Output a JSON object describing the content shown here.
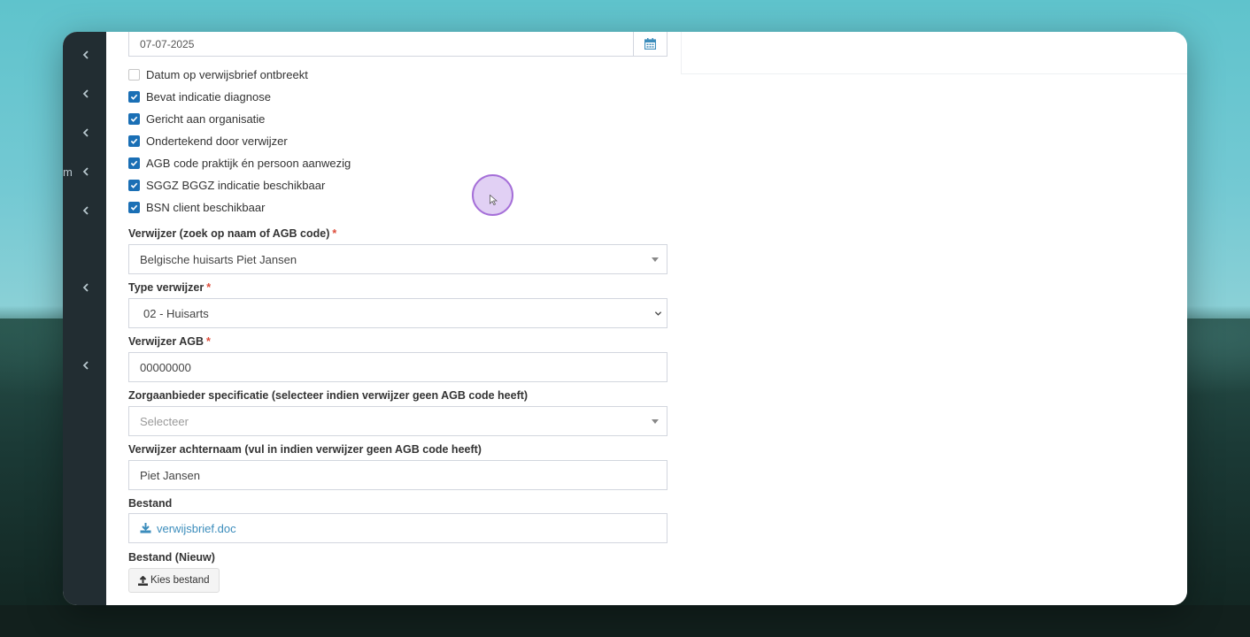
{
  "sidebar": {
    "letter": "m",
    "chevrons": [
      "chevron-left-icon",
      "chevron-left-icon",
      "chevron-left-icon",
      "chevron-left-icon",
      "chevron-left-icon",
      "chevron-left-icon",
      "chevron-left-icon"
    ]
  },
  "date_field": {
    "value": "07-07-2025",
    "icon": "calendar-icon"
  },
  "checkboxes": [
    {
      "label": "Datum op verwijsbrief ontbreekt",
      "checked": false
    },
    {
      "label": "Bevat indicatie diagnose",
      "checked": true
    },
    {
      "label": "Gericht aan organisatie",
      "checked": true
    },
    {
      "label": "Ondertekend door verwijzer",
      "checked": true
    },
    {
      "label": "AGB code praktijk én persoon aanwezig",
      "checked": true
    },
    {
      "label": "SGGZ BGGZ indicatie beschikbaar",
      "checked": true
    },
    {
      "label": "BSN client beschikbaar",
      "checked": true
    }
  ],
  "verwijzer": {
    "label": "Verwijzer (zoek op naam of AGB code)",
    "required": "*",
    "value": "Belgische huisarts Piet Jansen"
  },
  "type_verwijzer": {
    "label": "Type verwijzer",
    "required": "*",
    "value": "02 - Huisarts"
  },
  "verwijzer_agb": {
    "label": "Verwijzer AGB",
    "required": "*",
    "value": "00000000"
  },
  "zorgaanbieder": {
    "label": "Zorgaanbieder specificatie (selecteer indien verwijzer geen AGB code heeft)",
    "placeholder": "Selecteer"
  },
  "achternaam": {
    "label": "Verwijzer achternaam (vul in indien verwijzer geen AGB code heeft)",
    "value": "Piet Jansen"
  },
  "bestand": {
    "label": "Bestand",
    "file": "verwijsbrief.doc",
    "icon": "download-icon"
  },
  "bestand_nieuw": {
    "label": "Bestand (Nieuw)",
    "button": "Kies bestand",
    "icon": "upload-icon"
  },
  "colors": {
    "accent": "#3c8dbc",
    "checkbox": "#1a6fb5",
    "required": "#dd4b39",
    "sidebar": "#222d32"
  }
}
